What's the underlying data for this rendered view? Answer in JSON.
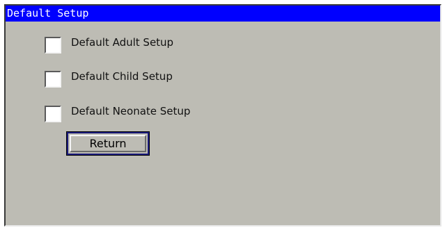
{
  "window": {
    "title": "Default Setup",
    "title_bg": "#0000ff",
    "background": "#bdbcb4"
  },
  "options": [
    {
      "label": "Default Adult Setup",
      "checked": false
    },
    {
      "label": "Default Child Setup",
      "checked": false
    },
    {
      "label": "Default Neonate Setup",
      "checked": false
    }
  ],
  "buttons": {
    "return_label": "Return"
  }
}
